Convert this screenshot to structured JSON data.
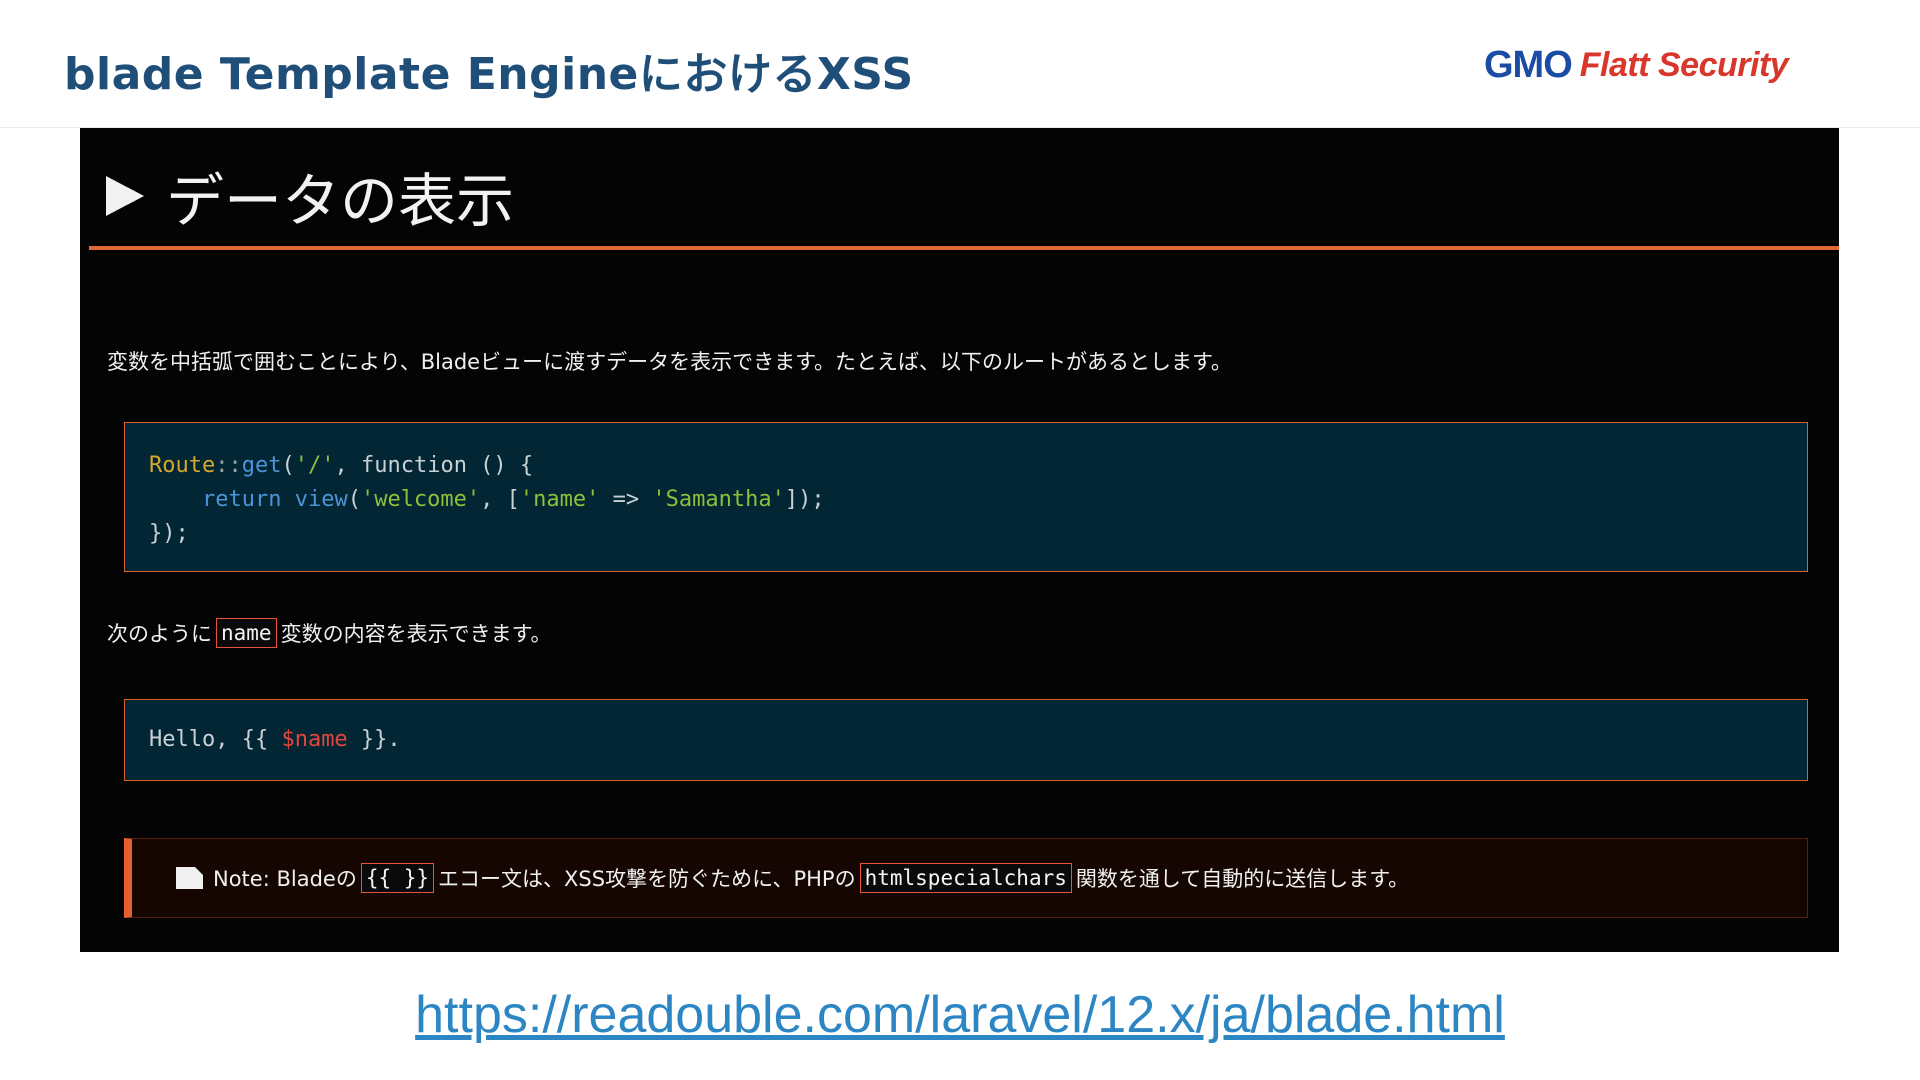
{
  "header": {
    "title": "blade Template EngineにおけるXSS",
    "logo_gmo": "GMO",
    "logo_flatt": "Flatt Security"
  },
  "doc": {
    "heading": "データの表示",
    "heading_icon": "play-triangle-icon",
    "intro": "変数を中括弧で囲むことにより、Bladeビューに渡すデータを表示できます。たとえば、以下のルートがあるとします。",
    "code1": {
      "line1": {
        "class": "Route",
        "sep": "::",
        "method": "get",
        "open": "(",
        "arg": "'/'",
        "rest": ", function () {"
      },
      "line2": {
        "indent": "    ",
        "kw": "return",
        "sp": " ",
        "fn": "view",
        "open": "(",
        "arg1": "'welcome'",
        "mid1": ", [",
        "key": "'name'",
        "arrow": " => ",
        "val": "'Samantha'",
        "close": "]);"
      },
      "line3": "});"
    },
    "para2": {
      "before": "次のように",
      "code": "name",
      "after": "変数の内容を表示できます。"
    },
    "code2": {
      "pre": "Hello, {{ ",
      "var": "$name",
      "post": " }}."
    },
    "note": {
      "icon": "note-icon",
      "part1": "Note: Bladeの",
      "code1": "{{ }}",
      "part2": "エコー文は、XSS攻撃を防ぐために、PHPの",
      "code2": "htmlspecialchars",
      "part3": "関数を通して自動的に送信します。"
    }
  },
  "source_url": "https://readouble.com/laravel/12.x/ja/blade.html",
  "colors": {
    "title": "#1f4e79",
    "accent_orange": "#e06a35",
    "code_bg": "#022634",
    "link": "#2d86c4"
  }
}
